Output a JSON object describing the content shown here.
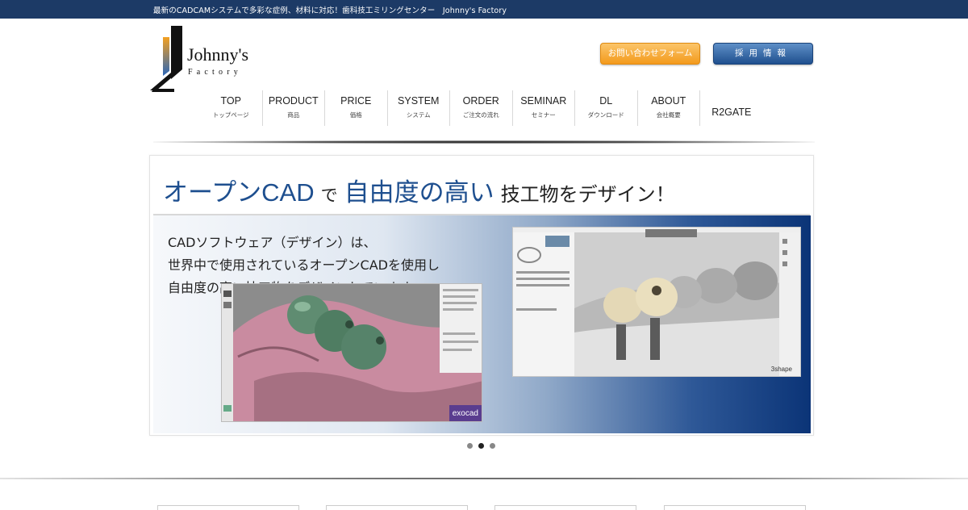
{
  "topbar": {
    "text": "最新のCADCAMシステムで多彩な症例、材料に対応！歯科技工ミリングセンター　Johnny's Factory"
  },
  "logo": {
    "line1": "Johnny's",
    "line2": "Factory"
  },
  "header": {
    "contact_label": "お問い合わせフォーム",
    "recruit_label": "採用情報"
  },
  "nav": [
    {
      "en": "TOP",
      "ja": "トップページ"
    },
    {
      "en": "PRODUCT",
      "ja": "商品"
    },
    {
      "en": "PRICE",
      "ja": "価格"
    },
    {
      "en": "SYSTEM",
      "ja": "システム"
    },
    {
      "en": "ORDER",
      "ja": "ご注文の流れ"
    },
    {
      "en": "SEMINAR",
      "ja": "セミナー"
    },
    {
      "en": "DL",
      "ja": "ダウンロード"
    },
    {
      "en": "ABOUT",
      "ja": "会社概要"
    },
    {
      "en": "R2GATE",
      "ja": ""
    }
  ],
  "slide": {
    "title_part1": "オープンCAD",
    "title_part2": "で",
    "title_part3": "自由度の高い",
    "title_part4": "技工物をデザイン！",
    "copy_lines": [
      "CADソフトウェア（デザイン）は、",
      "世界中で使用されているオープンCADを使用し",
      "自由度の高い技工物をデザインしています。"
    ],
    "shot_a_brand": "exocad",
    "shot_b_brand": "3shape"
  },
  "slider_dots": {
    "count": 3,
    "active": 2
  },
  "colors": {
    "topbar": "#1c3a66",
    "accent_blue": "#1e4f8f",
    "contact_orange": "#f39a1c",
    "recruit_blue": "#1f4f8e"
  }
}
